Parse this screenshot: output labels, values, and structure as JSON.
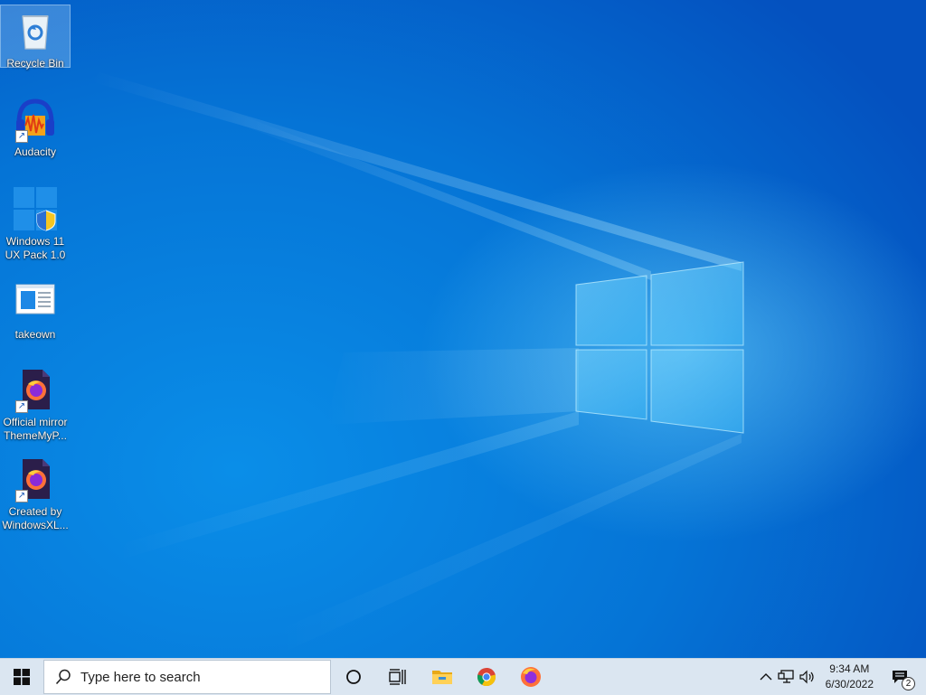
{
  "desktop": {
    "icons": [
      {
        "label": "Recycle Bin",
        "icon": "recycle-bin-icon"
      },
      {
        "label": "Audacity",
        "icon": "audacity-icon"
      },
      {
        "label": "Windows 11 UX Pack 1.0",
        "icon": "windows-ux-pack-icon"
      },
      {
        "label": "takeown",
        "icon": "takeown-app-icon"
      },
      {
        "label": "Official mirror ThemeMyP...",
        "icon": "firefox-file-icon"
      },
      {
        "label": "Created by WindowsXL...",
        "icon": "firefox-file-icon"
      }
    ]
  },
  "taskbar": {
    "start_icon": "windows-start-icon",
    "search_placeholder": "Type here to search",
    "pinned": [
      {
        "name": "cortana",
        "icon": "cortana-circle-icon"
      },
      {
        "name": "task-view",
        "icon": "task-view-icon"
      },
      {
        "name": "file-explorer",
        "icon": "folder-icon"
      },
      {
        "name": "chrome",
        "icon": "chrome-icon"
      },
      {
        "name": "firefox",
        "icon": "firefox-icon"
      }
    ],
    "tray": {
      "time": "9:34 AM",
      "date": "6/30/2022",
      "notification_count": "2"
    }
  },
  "colors": {
    "desktop_blue": "#0574d6",
    "taskbar_bg": "#dbe6f1"
  }
}
